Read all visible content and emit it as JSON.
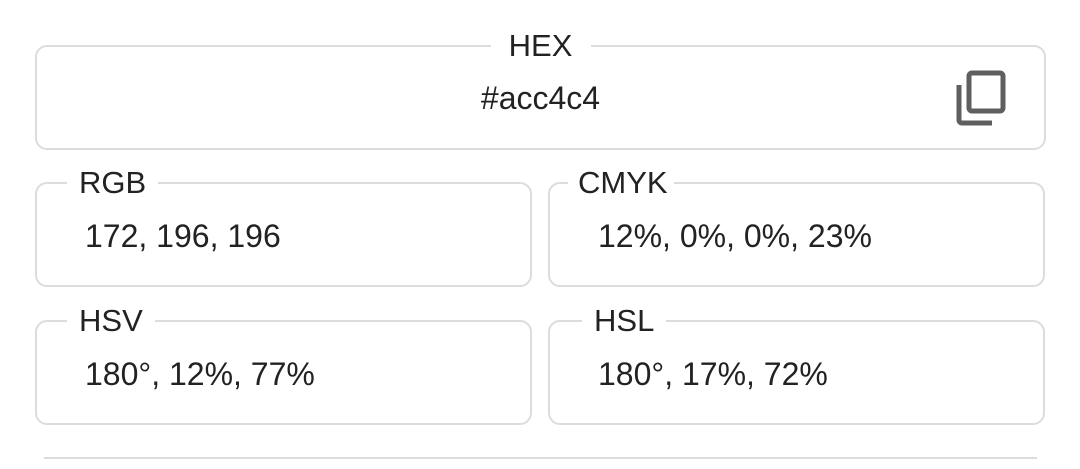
{
  "hex": {
    "label": "HEX",
    "value": "#acc4c4",
    "copy_icon": "content-copy-icon"
  },
  "rgb": {
    "label": "RGB",
    "value": "172, 196, 196"
  },
  "cmyk": {
    "label": "CMYK",
    "value": "12%, 0%, 0%, 23%"
  },
  "hsv": {
    "label": "HSV",
    "value": "180°, 12%, 77%"
  },
  "hsl": {
    "label": "HSL",
    "value": "180°, 17%, 72%"
  }
}
